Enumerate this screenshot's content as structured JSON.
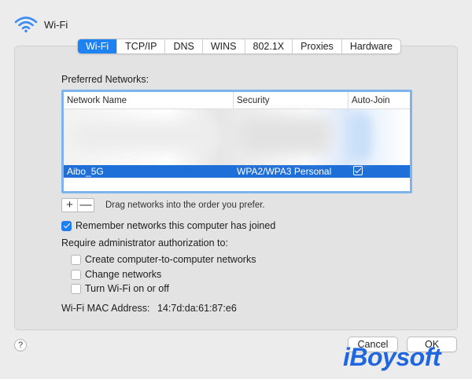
{
  "header": {
    "title": "Wi-Fi",
    "icon": "wifi-icon"
  },
  "tabs": [
    {
      "label": "Wi-Fi",
      "active": true
    },
    {
      "label": "TCP/IP",
      "active": false
    },
    {
      "label": "DNS",
      "active": false
    },
    {
      "label": "WINS",
      "active": false
    },
    {
      "label": "802.1X",
      "active": false
    },
    {
      "label": "Proxies",
      "active": false
    },
    {
      "label": "Hardware",
      "active": false
    }
  ],
  "preferred": {
    "label": "Preferred Networks:",
    "columns": [
      "Network Name",
      "Security",
      "Auto-Join"
    ],
    "selected_row": {
      "name": "Aibo_5G",
      "security": "WPA2/WPA3 Personal",
      "auto_join": true
    }
  },
  "list_controls": {
    "add": "+",
    "remove": "—",
    "hint": "Drag networks into the order you prefer."
  },
  "options": {
    "remember": {
      "label": "Remember networks this computer has joined",
      "checked": true
    },
    "require_label": "Require administrator authorization to:",
    "create_networks": {
      "label": "Create computer-to-computer networks",
      "checked": false
    },
    "change_networks": {
      "label": "Change networks",
      "checked": false
    },
    "turn_wifi": {
      "label": "Turn Wi-Fi on or off",
      "checked": false
    }
  },
  "mac": {
    "label": "Wi-Fi MAC Address:",
    "value": "14:7d:da:61:87:e6"
  },
  "footer": {
    "help": "?",
    "cancel": "Cancel",
    "ok": "OK"
  },
  "watermark": "iBoysoft",
  "colors": {
    "accent": "#1f82f2",
    "selection": "#1f6fd8",
    "watermark": "#1f66e0"
  }
}
